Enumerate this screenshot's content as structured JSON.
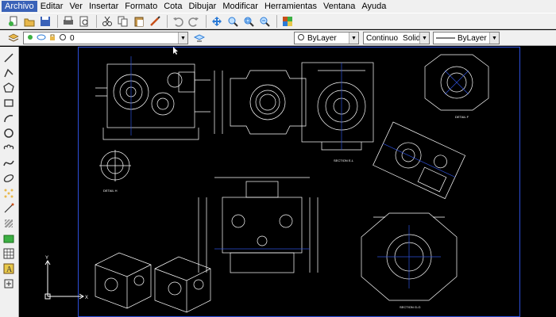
{
  "menu": {
    "items": [
      {
        "label": "Archivo",
        "active": true
      },
      {
        "label": "Editar"
      },
      {
        "label": "Ver"
      },
      {
        "label": "Insertar"
      },
      {
        "label": "Formato"
      },
      {
        "label": "Cota"
      },
      {
        "label": "Dibujar"
      },
      {
        "label": "Modificar"
      },
      {
        "label": "Herramientas"
      },
      {
        "label": "Ventana"
      },
      {
        "label": "Ayuda"
      }
    ]
  },
  "layers": {
    "current_layer": "0"
  },
  "properties": {
    "color": "ByLayer",
    "linetype": "Continuo",
    "linetype_desc": "Solid line",
    "lineweight": "ByLayer"
  },
  "drawing": {
    "labels": {
      "section_el": "SECTION E-L",
      "section_gg": "SECTION G-G",
      "detail_f": "DETAIL F",
      "detail_h": "DETAIL H"
    },
    "colors": {
      "background": "#000000",
      "linework": "#ffffff",
      "border": "#2c4fd9",
      "menu_active": "#3a62b8"
    }
  }
}
